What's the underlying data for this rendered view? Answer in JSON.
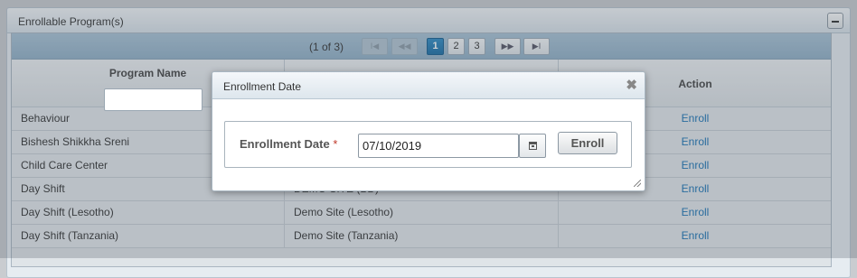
{
  "panel": {
    "title": "Enrollable Program(s)"
  },
  "paginator": {
    "info": "(1 of 3)",
    "first": "I◀",
    "prev": "◀◀",
    "next": "▶▶",
    "last": "▶I",
    "pages": [
      "1",
      "2",
      "3"
    ],
    "current_page": "1"
  },
  "table": {
    "headers": {
      "program_name": "Program Name",
      "site": "",
      "action": "Action"
    },
    "rows": [
      {
        "program": "Behaviour",
        "site": "",
        "action": "Enroll"
      },
      {
        "program": "Bishesh Shikkha Sreni",
        "site": "",
        "action": "Enroll"
      },
      {
        "program": "Child Care Center",
        "site": "",
        "action": "Enroll"
      },
      {
        "program": "Day Shift",
        "site": "DEMO SITE (BD)",
        "action": "Enroll"
      },
      {
        "program": "Day Shift (Lesotho)",
        "site": "Demo Site (Lesotho)",
        "action": "Enroll"
      },
      {
        "program": "Day Shift (Tanzania)",
        "site": "Demo Site (Tanzania)",
        "action": "Enroll"
      }
    ]
  },
  "dialog": {
    "title": "Enrollment Date",
    "close_glyph": "✖",
    "field_label": "Enrollment Date",
    "required_mark": "*",
    "date_value": "07/10/2019",
    "enroll_button": "Enroll"
  },
  "colors": {
    "accent": "#1a73b5",
    "active_page": "#2f8bc5",
    "required": "#c0392b"
  }
}
